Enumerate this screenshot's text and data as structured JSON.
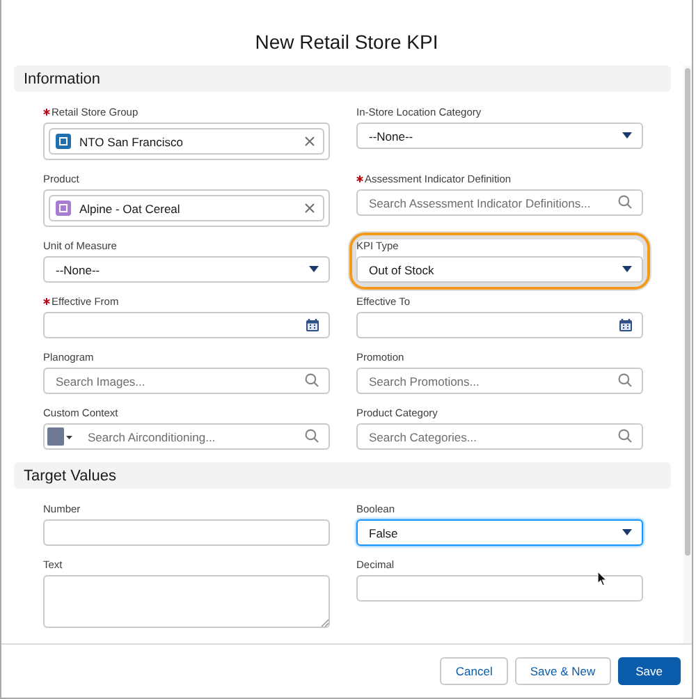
{
  "dialog": {
    "title": "New Retail Store KPI"
  },
  "sections": [
    {
      "title": "Information",
      "fields": [
        {
          "label": "Retail Store Group",
          "required": true,
          "kind": "lookup",
          "value": "NTO San Francisco",
          "color": "#1f6fae",
          "highlighted": false,
          "focused": false
        },
        {
          "label": "In-Store Location Category",
          "required": false,
          "kind": "select",
          "value": "--None--",
          "highlighted": false,
          "focused": false
        },
        {
          "label": "Product",
          "required": false,
          "kind": "lookup",
          "value": "Alpine - Oat Cereal",
          "color": "#a77cd3",
          "highlighted": false,
          "focused": false
        },
        {
          "label": "Assessment Indicator Definition",
          "required": true,
          "kind": "search",
          "placeholder": "Search Assessment Indicator Definitions...",
          "highlighted": false,
          "focused": false
        },
        {
          "label": "Unit of Measure",
          "required": false,
          "kind": "select",
          "value": "--None--",
          "highlighted": false,
          "focused": false
        },
        {
          "label": "KPI Type",
          "required": false,
          "kind": "select",
          "value": "Out of Stock",
          "highlighted": true,
          "focused": false
        },
        {
          "label": "Effective From",
          "required": true,
          "kind": "date",
          "highlighted": false,
          "focused": false
        },
        {
          "label": "Effective To",
          "required": false,
          "kind": "date",
          "highlighted": false,
          "focused": false
        },
        {
          "label": "Planogram",
          "required": false,
          "kind": "search",
          "placeholder": "Search Images...",
          "highlighted": false,
          "focused": false
        },
        {
          "label": "Promotion",
          "required": false,
          "kind": "search",
          "placeholder": "Search Promotions...",
          "highlighted": false,
          "focused": false
        },
        {
          "label": "Custom Context",
          "required": false,
          "kind": "context_search",
          "placeholder": "Search Airconditioning...",
          "highlighted": false,
          "focused": false
        },
        {
          "label": "Product Category",
          "required": false,
          "kind": "search",
          "placeholder": "Search Categories...",
          "highlighted": false,
          "focused": false
        }
      ]
    },
    {
      "title": "Target Values",
      "fields": [
        {
          "label": "Number",
          "required": false,
          "kind": "text",
          "highlighted": false,
          "focused": false
        },
        {
          "label": "Boolean",
          "required": false,
          "kind": "select",
          "value": "False",
          "highlighted": false,
          "focused": true
        },
        {
          "label": "Text",
          "required": false,
          "kind": "textarea",
          "highlighted": false,
          "focused": false
        },
        {
          "label": "Decimal",
          "required": false,
          "kind": "text",
          "highlighted": false,
          "focused": false
        }
      ]
    }
  ],
  "buttons": [
    {
      "label": "Cancel",
      "kind": "neutral"
    },
    {
      "label": "Save & New",
      "kind": "neutral"
    },
    {
      "label": "Save",
      "kind": "brand"
    }
  ]
}
